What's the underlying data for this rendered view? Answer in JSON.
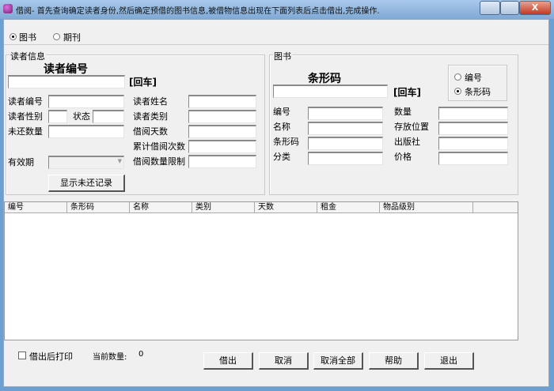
{
  "window": {
    "title": "借阅- 首先查询确定读者身份,然后确定预借的图书信息,被借物信息出现在下面列表后点击借出,完成操作.",
    "close_label": "X"
  },
  "type_options": [
    {
      "label": "图书",
      "selected": true
    },
    {
      "label": "期刊",
      "selected": false
    }
  ],
  "reader": {
    "group_title": "读者信息",
    "heading": "读者编号",
    "enter_hint": "[回车]",
    "search_value": "",
    "fields": {
      "id": "读者编号",
      "gender": "读者性别",
      "status": "状态",
      "unreturned": "未还数量",
      "validity": "有效期",
      "name": "读者姓名",
      "category": "读者类别",
      "days": "借阅天数",
      "total": "累计借阅次数",
      "limit": "借阅数量限制"
    },
    "show_unreturned_button": "显示未还记录"
  },
  "book": {
    "group_title": "图书",
    "heading": "条形码",
    "enter_hint": "[回车]",
    "search_value": "",
    "search_mode": [
      {
        "label": "编号",
        "selected": false
      },
      {
        "label": "条形码",
        "selected": true
      }
    ],
    "fields": {
      "id": "编号",
      "name": "名称",
      "barcode": "条形码",
      "category": "分类",
      "quantity": "数量",
      "location": "存放位置",
      "publisher": "出版社",
      "price": "价格"
    }
  },
  "table": {
    "columns": [
      "编号",
      "条形码",
      "名称",
      "类别",
      "天数",
      "租金",
      "物品级别"
    ],
    "rows": []
  },
  "footer": {
    "print_after_label": "借出后打印",
    "print_after_checked": false,
    "count_label": "当前数量:",
    "count_value": "0",
    "buttons": [
      "借出",
      "取消",
      "取消全部",
      "帮助",
      "退出"
    ]
  }
}
